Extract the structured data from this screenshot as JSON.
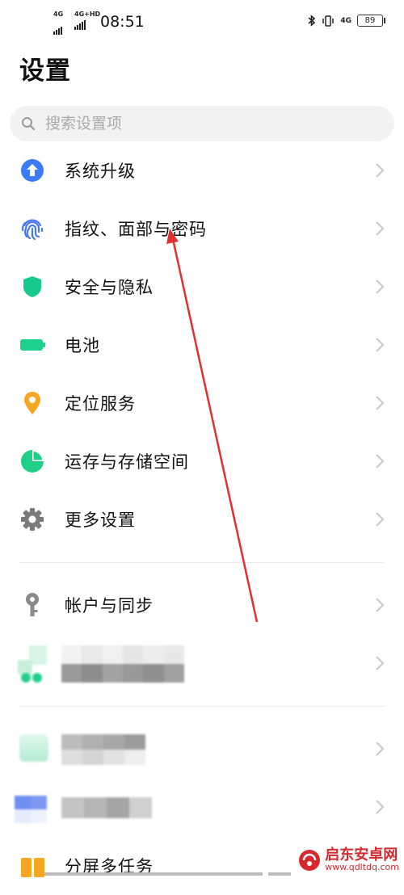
{
  "status_bar": {
    "sim1": "4G",
    "sim2": "4G+HD",
    "time": "08:51",
    "net": "4G",
    "battery": "89"
  },
  "page_title": "设置",
  "search": {
    "placeholder": "搜索设置项"
  },
  "items": [
    {
      "label": "系统升级",
      "icon": "upgrade-icon",
      "color": "#3b7bf5"
    },
    {
      "label": "指纹、面部与密码",
      "icon": "fingerprint-icon",
      "color": "#4a78f0"
    },
    {
      "label": "安全与隐私",
      "icon": "shield-icon",
      "color": "#16c98d"
    },
    {
      "label": "电池",
      "icon": "battery-icon",
      "color": "#1dd08c"
    },
    {
      "label": "定位服务",
      "icon": "location-pin-icon",
      "color": "#f5a623"
    },
    {
      "label": "运存与存储空间",
      "icon": "storage-pie-icon",
      "color": "#1fcf87"
    },
    {
      "label": "更多设置",
      "icon": "gear-icon",
      "color": "#7a7a7a"
    },
    {
      "label": "帐户与同步",
      "icon": "key-icon",
      "color": "#8a8a8a"
    },
    {
      "label": "分屏多任务",
      "icon": "split-screen-icon",
      "color": "#f5a623"
    }
  ],
  "watermark": {
    "brand": "启东安卓网",
    "url": "www.qdltdq.com"
  },
  "colors": {
    "chevron": "#c7c7c7",
    "annotation_arrow": "#e03030"
  }
}
